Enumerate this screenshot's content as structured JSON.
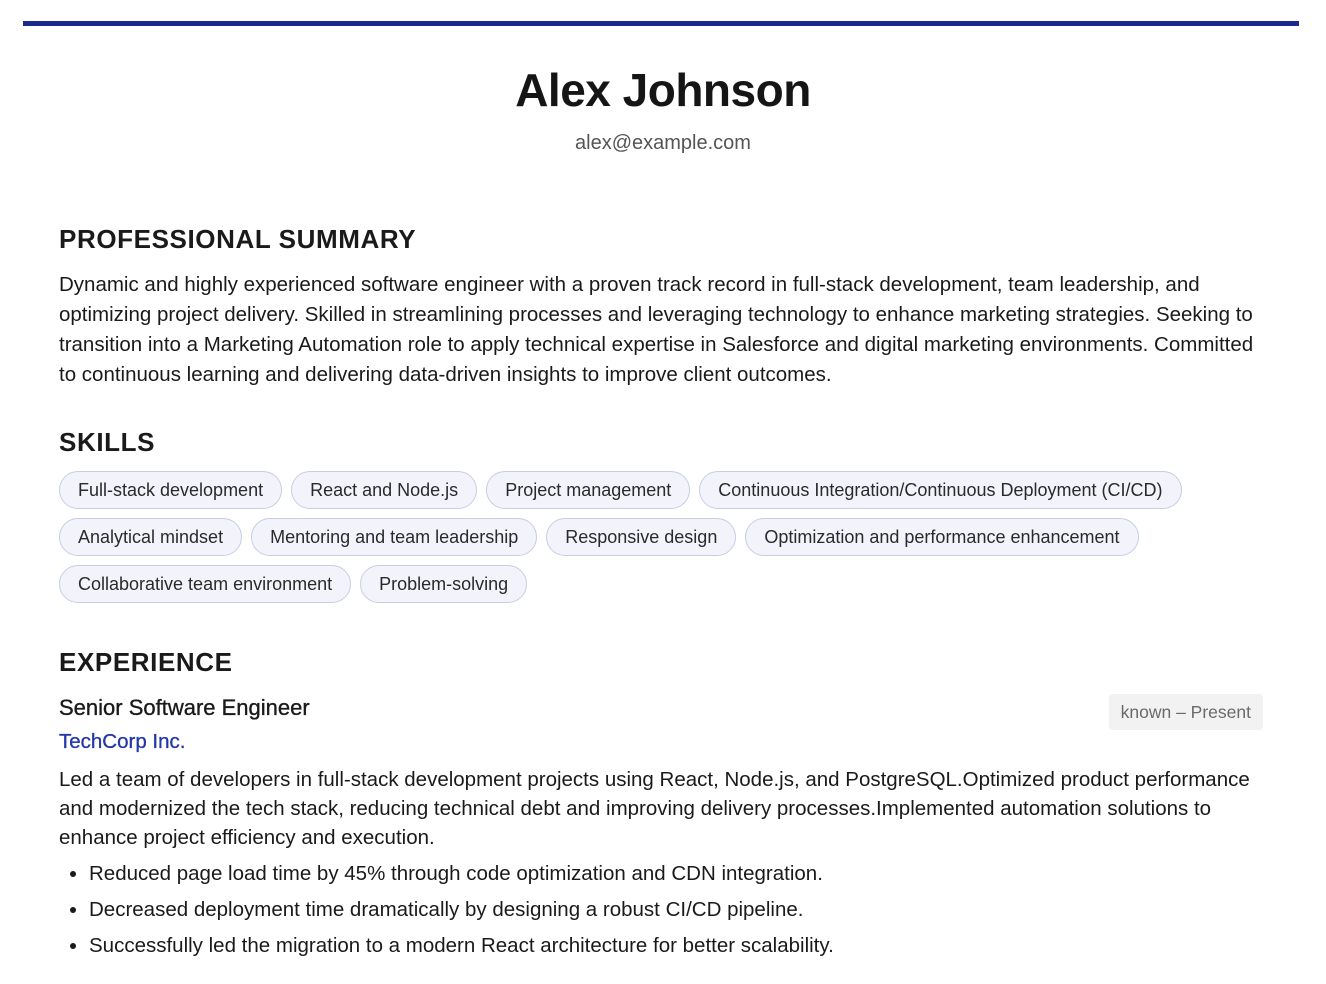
{
  "header": {
    "name": "Alex Johnson",
    "email": "alex@example.com"
  },
  "summary": {
    "heading": "PROFESSIONAL SUMMARY",
    "text": "Dynamic and highly experienced software engineer with a proven track record in full-stack development, team leadership, and optimizing project delivery. Skilled in streamlining processes and leveraging technology to enhance marketing strategies. Seeking to transition into a Marketing Automation role to apply technical expertise in Salesforce and digital marketing environments. Committed to continuous learning and delivering data-driven insights to improve client outcomes."
  },
  "skills": {
    "heading": "SKILLS",
    "items": [
      "Full-stack development",
      "React and Node.js",
      "Project management",
      "Continuous Integration/Continuous Deployment (CI/CD)",
      "Analytical mindset",
      "Mentoring and team leadership",
      "Responsive design",
      "Optimization and performance enhancement",
      "Collaborative team environment",
      "Problem-solving"
    ]
  },
  "experience": {
    "heading": "EXPERIENCE",
    "jobs": [
      {
        "title": "Senior Software Engineer",
        "dates": "known – Present",
        "company": "TechCorp Inc.",
        "description": "Led a team of developers in full-stack development projects using React, Node.js, and PostgreSQL.Optimized product performance and modernized the tech stack, reducing technical debt and improving delivery processes.Implemented automation solutions to enhance project efficiency and execution.",
        "bullets": [
          "Reduced page load time by 45% through code optimization and CDN integration.",
          "Decreased deployment time dramatically by designing a robust CI/CD pipeline.",
          "Successfully led the migration to a modern React architecture for better scalability."
        ]
      }
    ]
  },
  "colors": {
    "accent": "#1a2a8c",
    "company": "#2438a8",
    "chip_border": "#c8cce6",
    "chip_bg": "#f3f4fb"
  }
}
